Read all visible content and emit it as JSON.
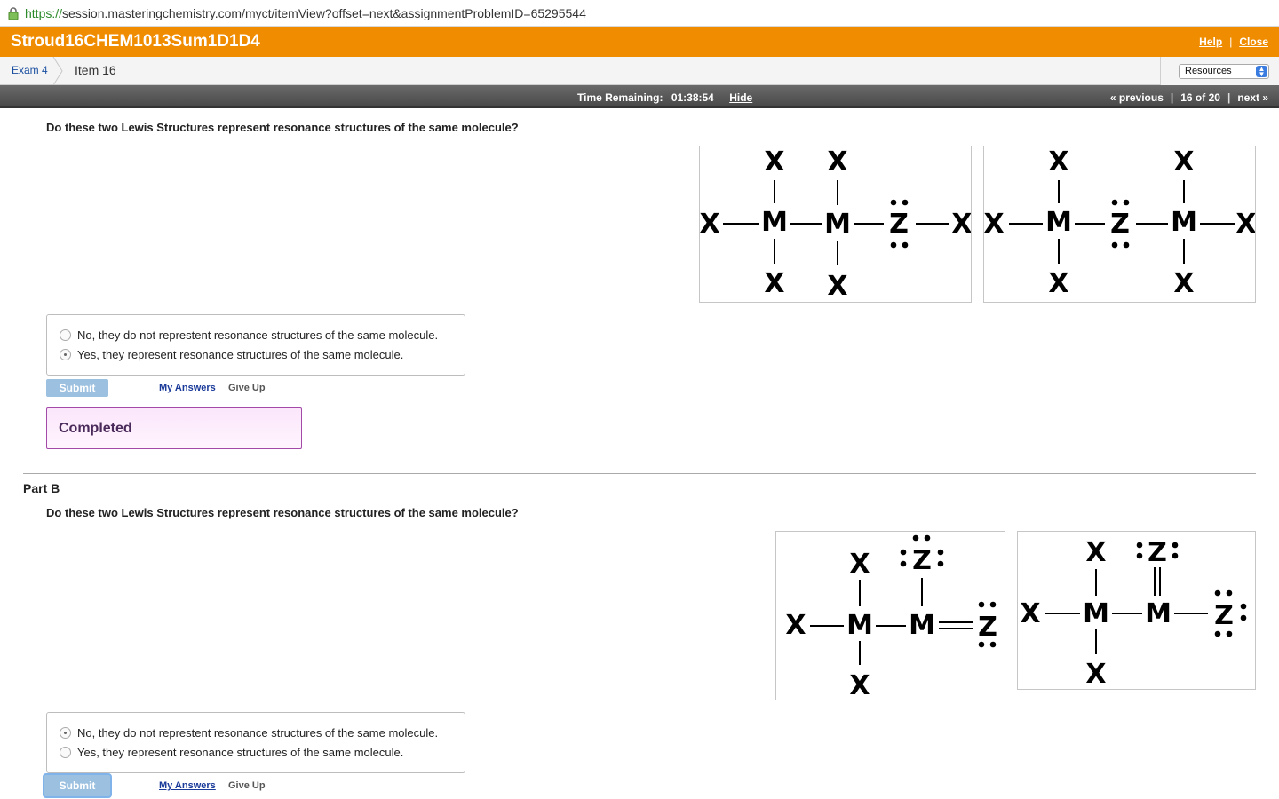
{
  "browser": {
    "url_scheme": "https://",
    "url_rest": "session.masteringchemistry.com/myct/itemView?offset=next&assignmentProblemID=65295544"
  },
  "header": {
    "title": "Stroud16CHEM1013Sum1D1D4",
    "help_label": "Help",
    "close_label": "Close"
  },
  "breadcrumb": {
    "exam_label": "Exam 4",
    "item_label": "Item 16",
    "resources_label": "Resources"
  },
  "timebar": {
    "time_label": "Time Remaining:",
    "time_value": "01:38:54",
    "hide_label": "Hide",
    "previous_label": "« previous",
    "position_label": "16 of 20",
    "next_label": "next »"
  },
  "part_a": {
    "question": "Do these two Lewis Structures represent resonance structures of the same molecule?",
    "options": [
      {
        "label": "No, they do not represtent resonance structures of the same molecule.",
        "selected": false
      },
      {
        "label": "Yes, they represent resonance structures of the same molecule.",
        "selected": true
      }
    ],
    "submit_label": "Submit",
    "my_answers_label": "My Answers",
    "give_up_label": "Give Up",
    "completed_label": "Completed"
  },
  "part_b": {
    "title": "Part B",
    "question": "Do these two Lewis Structures represent resonance structures of the same molecule?",
    "options": [
      {
        "label": "No, they do not represtent resonance structures of the same molecule.",
        "selected": true
      },
      {
        "label": "Yes, they represent resonance structures of the same molecule.",
        "selected": false
      }
    ],
    "submit_label": "Submit",
    "my_answers_label": "My Answers",
    "give_up_label": "Give Up"
  },
  "atoms": {
    "x": "X",
    "m": "M",
    "z": "Z"
  }
}
